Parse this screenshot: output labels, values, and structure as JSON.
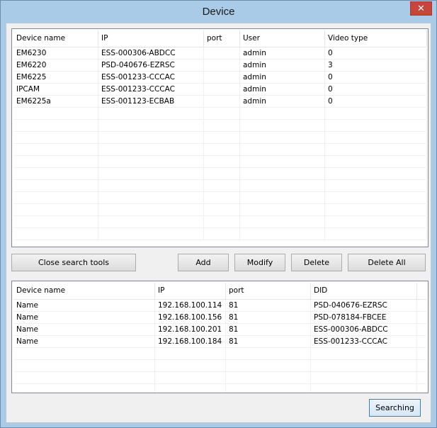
{
  "window": {
    "title": "Device",
    "close_glyph": "✕"
  },
  "device_table": {
    "columns": [
      "Device name",
      "IP",
      "port",
      "User",
      "Video type"
    ],
    "rows": [
      [
        "EM6230",
        "ESS-000306-ABDCC",
        "",
        "admin",
        "0"
      ],
      [
        "EM6220",
        "PSD-040676-EZRSC",
        "",
        "admin",
        "3"
      ],
      [
        "EM6225",
        "ESS-001233-CCCAC",
        "",
        "admin",
        "0"
      ],
      [
        "IPCAM",
        "ESS-001233-CCCAC",
        "",
        "admin",
        "0"
      ],
      [
        "EM6225a",
        "ESS-001123-ECBAB",
        "",
        "admin",
        "0"
      ]
    ]
  },
  "buttons": {
    "close_search": "Close search tools",
    "add": "Add",
    "modify": "Modify",
    "delete": "Delete",
    "delete_all": "Delete All",
    "searching": "Searching"
  },
  "search_table": {
    "columns": [
      "Device name",
      "IP",
      "port",
      "DID"
    ],
    "rows": [
      [
        "Name",
        "192.168.100.114",
        "81",
        "PSD-040676-EZRSC"
      ],
      [
        "Name",
        "192.168.100.156",
        "81",
        "PSD-078184-FBCEE"
      ],
      [
        "Name",
        "192.168.100.201",
        "81",
        "ESS-000306-ABDCC"
      ],
      [
        "Name",
        "192.168.100.184",
        "81",
        "ESS-001233-CCCAC"
      ]
    ]
  },
  "colors": {
    "title_bar": "#a9cbe8",
    "close_button": "#c7463c",
    "window_bg": "#f0f0f0"
  }
}
